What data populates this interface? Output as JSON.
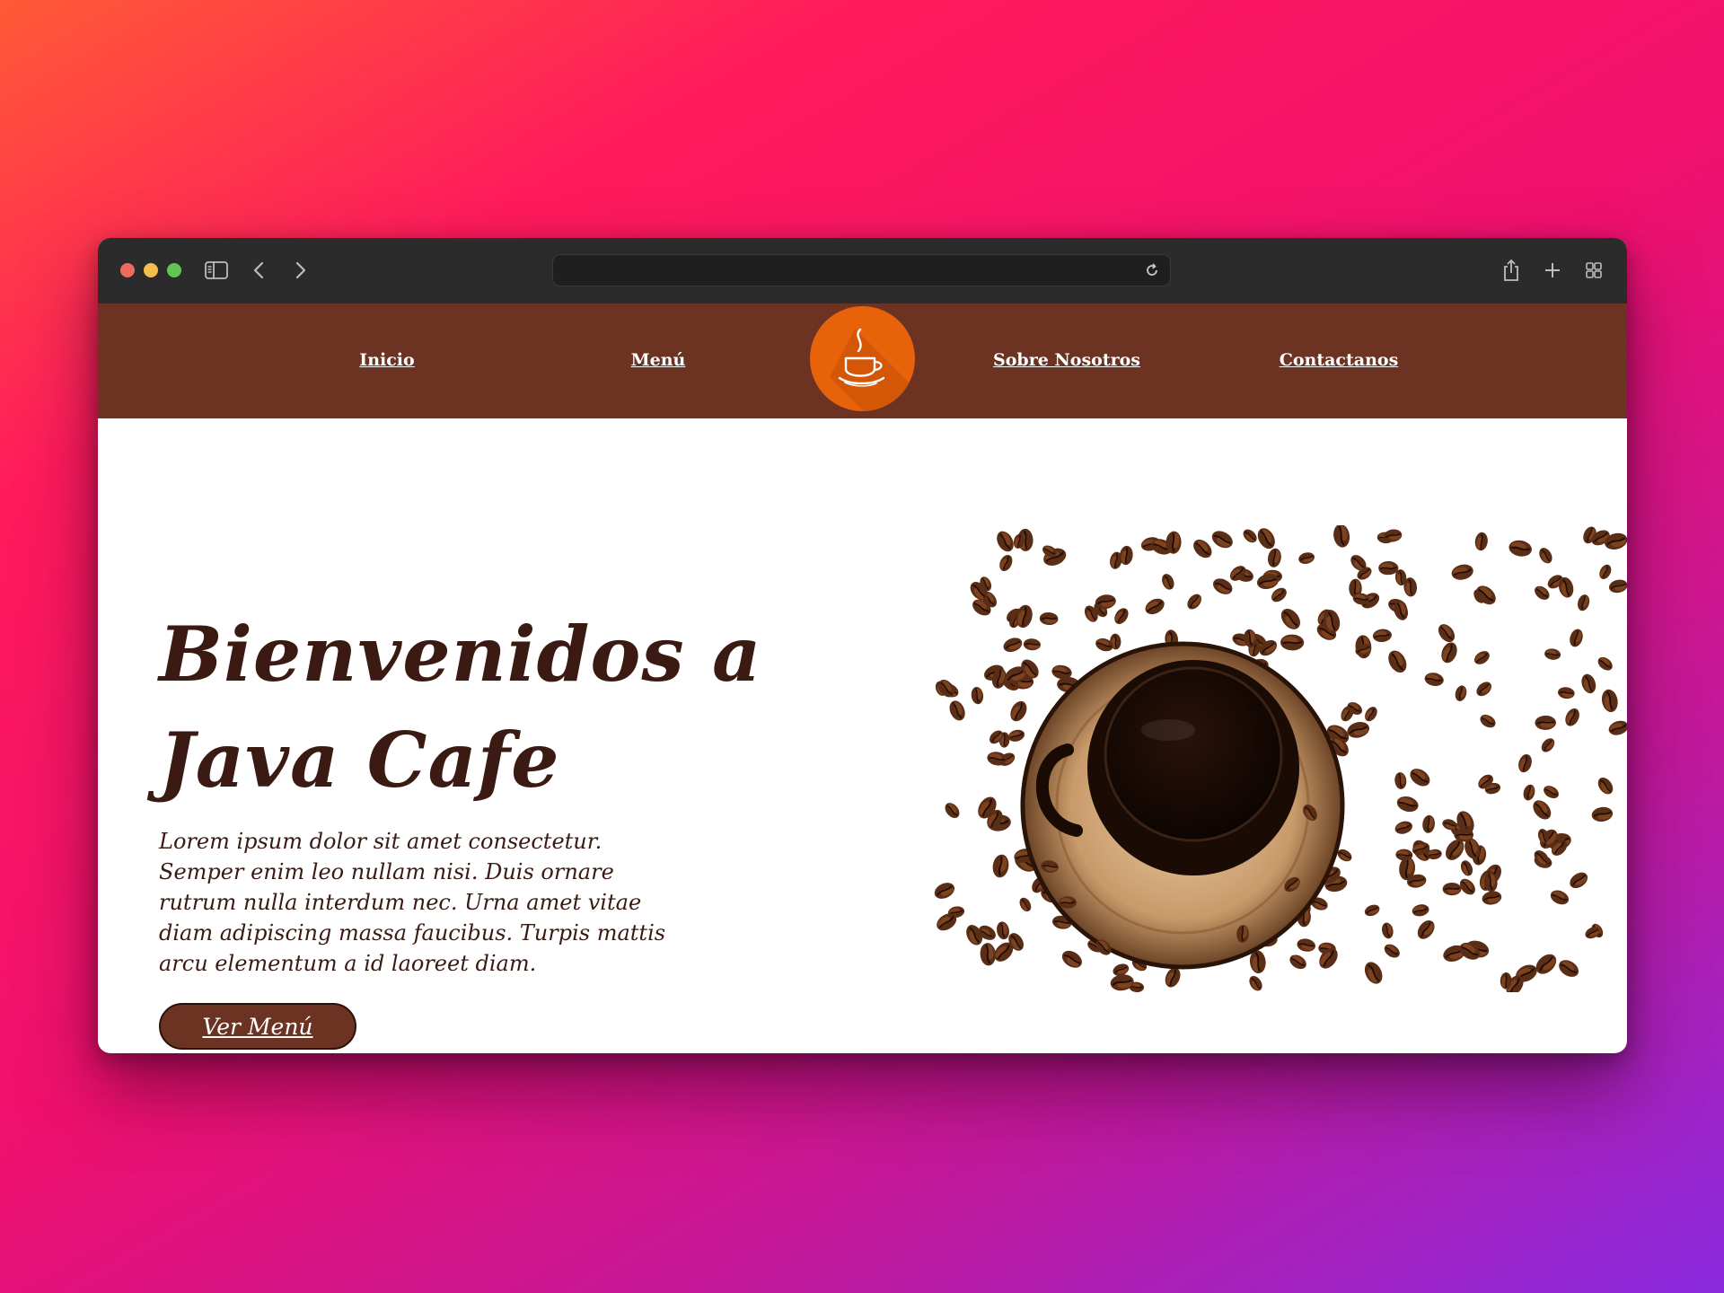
{
  "browser": {
    "icons": [
      "sidebar-toggle-icon",
      "back-icon",
      "forward-icon",
      "reload-icon",
      "share-icon",
      "new-tab-icon",
      "tab-overview-icon"
    ],
    "url": ""
  },
  "nav": {
    "links": [
      {
        "label": "Inicio"
      },
      {
        "label": "Menú"
      },
      {
        "label": "Sobre Nosotros"
      },
      {
        "label": "Contactanos"
      }
    ],
    "logo_icon": "coffee-cup-icon"
  },
  "hero": {
    "title_line1": "Bienvenidos a",
    "title_line2": "Java Cafe",
    "text": "Lorem ipsum dolor sit amet consectetur. Semper enim leo nullam nisi. Duis ornare rutrum nulla interdum nec. Urna amet vitae diam adipiscing massa faucibus. Turpis mattis arcu elementum a id laoreet diam.",
    "button_label": "Ver Menú",
    "image_subject": "coffee-cup-with-beans-image"
  },
  "colors": {
    "navbar": "#6c3322",
    "logo": "#e8620a",
    "text_dark": "#3a1a12",
    "button": "#6c3322"
  }
}
